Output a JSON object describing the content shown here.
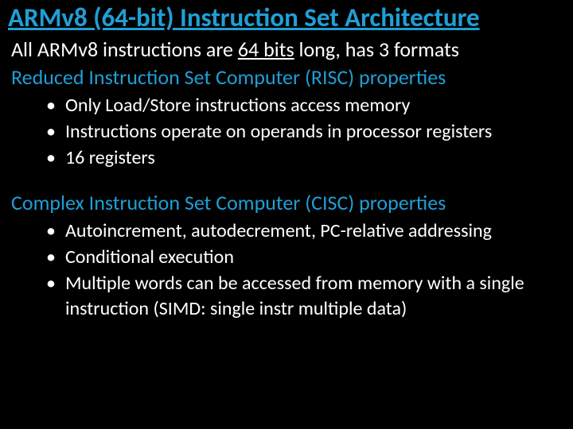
{
  "title": "ARMv8 (64-bit) Instruction Set Architecture",
  "line1_a": "All ARMv8 instructions are ",
  "line1_b": "64 bits",
  "line1_c": " long, has 3 formats",
  "section1": "Reduced Instruction Set Computer (RISC) properties",
  "sub1": [
    "Only Load/Store instructions access memory",
    "Instructions operate on operands in processor registers",
    "16 registers"
  ],
  "section2": "Complex Instruction Set Computer (CISC) properties",
  "sub2": [
    "Autoincrement, autodecrement, PC-relative addressing",
    "Conditional execution",
    "Multiple words can be accessed from memory with a single instruction (SIMD: single instr multiple data)"
  ]
}
